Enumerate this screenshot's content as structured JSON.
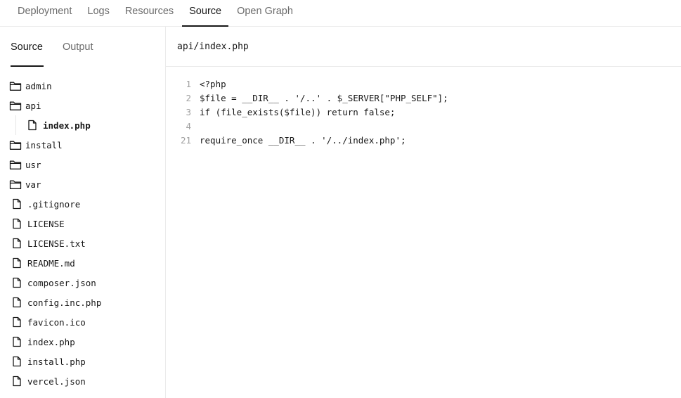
{
  "top_tabs": [
    {
      "label": "Deployment"
    },
    {
      "label": "Logs"
    },
    {
      "label": "Resources"
    },
    {
      "label": "Source",
      "active": true
    },
    {
      "label": "Open Graph"
    }
  ],
  "side_tabs": [
    {
      "label": "Source",
      "active": true
    },
    {
      "label": "Output"
    }
  ],
  "tree": {
    "admin": "admin",
    "api": "api",
    "api_index": "index.php",
    "install": "install",
    "usr": "usr",
    "var": "var",
    "files": [
      ".gitignore",
      "LICENSE",
      "LICENSE.txt",
      "README.md",
      "composer.json",
      "config.inc.php",
      "favicon.ico",
      "index.php",
      "install.php",
      "vercel.json"
    ]
  },
  "file_header": {
    "path": "api/index.php"
  },
  "code": {
    "lines": [
      {
        "num": "1",
        "text": "<?php"
      },
      {
        "num": "2",
        "text": "$file = __DIR__ . '/..' . $_SERVER[\"PHP_SELF\"];"
      },
      {
        "num": "3",
        "text": "if (file_exists($file)) return false;"
      },
      {
        "num": "4",
        "text": ""
      },
      {
        "num": "21",
        "text": "require_once __DIR__ . '/../index.php';"
      }
    ]
  },
  "icons": {
    "folder": "folder-icon",
    "file": "file-icon"
  }
}
